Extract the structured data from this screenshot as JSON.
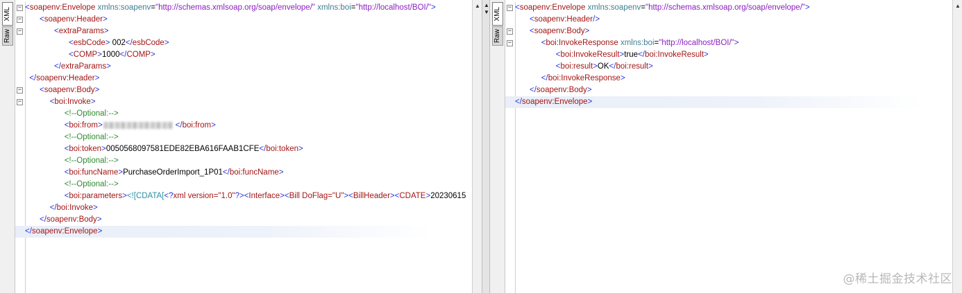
{
  "left_pane": {
    "tabs": {
      "xml": "XML",
      "raw": "Raw"
    },
    "lines": [
      {
        "fold": "⊟",
        "indent": 0,
        "tokens": [
          [
            "br",
            "<"
          ],
          [
            "tag",
            "soapenv:Envelope"
          ],
          [
            "txt",
            " "
          ],
          [
            "attr",
            "xmlns:soapenv"
          ],
          [
            "txt",
            "="
          ],
          [
            "val",
            "\"http://schemas.xmlsoap.org/soap/envelope/\""
          ],
          [
            "txt",
            " "
          ],
          [
            "attr",
            "xmlns:boi"
          ],
          [
            "txt",
            "="
          ],
          [
            "val",
            "\"http://localhost/BOI/\""
          ],
          [
            "br",
            ">"
          ]
        ]
      },
      {
        "fold": "⊟",
        "indent": 1,
        "tokens": [
          [
            "br",
            "<"
          ],
          [
            "tag",
            "soapenv:Header"
          ],
          [
            "br",
            ">"
          ]
        ]
      },
      {
        "fold": "⊟",
        "indent": 2,
        "tokens": [
          [
            "br",
            "<"
          ],
          [
            "tag",
            "extraParams"
          ],
          [
            "br",
            ">"
          ]
        ]
      },
      {
        "fold": "",
        "indent": 3,
        "tokens": [
          [
            "br",
            "<"
          ],
          [
            "tag",
            "esbCode"
          ],
          [
            "br",
            ">"
          ],
          [
            "txt",
            " 002"
          ],
          [
            "br",
            "</"
          ],
          [
            "tag",
            "esbCode"
          ],
          [
            "br",
            ">"
          ]
        ]
      },
      {
        "fold": "",
        "indent": 3,
        "tokens": [
          [
            "br",
            "<"
          ],
          [
            "tag",
            "COMP"
          ],
          [
            "br",
            ">"
          ],
          [
            "txt",
            "1000"
          ],
          [
            "br",
            "</"
          ],
          [
            "tag",
            "COMP"
          ],
          [
            "br",
            ">"
          ]
        ]
      },
      {
        "fold": "",
        "indent": 2,
        "tokens": [
          [
            "br",
            "</"
          ],
          [
            "tag",
            "extraParams"
          ],
          [
            "br",
            ">"
          ]
        ]
      },
      {
        "fold": "",
        "indent": 0.3,
        "tokens": [
          [
            "br",
            "</"
          ],
          [
            "tag",
            "soapenv:Header"
          ],
          [
            "br",
            ">"
          ]
        ]
      },
      {
        "fold": "⊟",
        "indent": 1,
        "tokens": [
          [
            "br",
            "<"
          ],
          [
            "tag",
            "soapenv:Body"
          ],
          [
            "br",
            ">"
          ]
        ]
      },
      {
        "fold": "⊟",
        "indent": 1.7,
        "tokens": [
          [
            "br",
            "<"
          ],
          [
            "tag",
            "boi:Invoke"
          ],
          [
            "br",
            ">"
          ]
        ]
      },
      {
        "fold": "",
        "indent": 2.7,
        "tokens": [
          [
            "com",
            "<!--Optional:-->"
          ]
        ]
      },
      {
        "fold": "",
        "indent": 2.7,
        "tokens": [
          [
            "br",
            "<"
          ],
          [
            "tag",
            "boi:from"
          ],
          [
            "br",
            ">"
          ],
          [
            "blur",
            ""
          ],
          [
            "br",
            "</"
          ],
          [
            "tag",
            "boi:from"
          ],
          [
            "br",
            ">"
          ]
        ]
      },
      {
        "fold": "",
        "indent": 2.7,
        "tokens": [
          [
            "com",
            "<!--Optional:-->"
          ]
        ]
      },
      {
        "fold": "",
        "indent": 2.7,
        "tokens": [
          [
            "br",
            "<"
          ],
          [
            "tag",
            "boi:token"
          ],
          [
            "br",
            ">"
          ],
          [
            "txt",
            "0050568097581EDE82EBA616FAAB1CFE"
          ],
          [
            "br",
            "</"
          ],
          [
            "tag",
            "boi:token"
          ],
          [
            "br",
            ">"
          ]
        ]
      },
      {
        "fold": "",
        "indent": 2.7,
        "tokens": [
          [
            "com",
            "<!--Optional:-->"
          ]
        ]
      },
      {
        "fold": "",
        "indent": 2.7,
        "tokens": [
          [
            "br",
            "<"
          ],
          [
            "tag",
            "boi:funcName"
          ],
          [
            "br",
            ">"
          ],
          [
            "txt",
            "PurchaseOrderImport_1P01"
          ],
          [
            "br",
            "</"
          ],
          [
            "tag",
            "boi:funcName"
          ],
          [
            "br",
            ">"
          ]
        ]
      },
      {
        "fold": "",
        "indent": 2.7,
        "tokens": [
          [
            "com",
            "<!--Optional:-->"
          ]
        ]
      },
      {
        "fold": "",
        "indent": 2.7,
        "tokens": [
          [
            "br",
            "<"
          ],
          [
            "tag",
            "boi:parameters"
          ],
          [
            "br",
            ">"
          ],
          [
            "cdata",
            "<![CDATA["
          ],
          [
            "br",
            "<?"
          ],
          [
            "tag",
            "xml version=\"1.0\""
          ],
          [
            "br",
            "?>"
          ],
          [
            "br",
            "<"
          ],
          [
            "tag",
            "Interface"
          ],
          [
            "br",
            ">"
          ],
          [
            "br",
            "<"
          ],
          [
            "tag",
            "Bill DoFlag=\"U\""
          ],
          [
            "br",
            ">"
          ],
          [
            "br",
            "<"
          ],
          [
            "tag",
            "BillHeader"
          ],
          [
            "br",
            ">"
          ],
          [
            "br",
            "<"
          ],
          [
            "tag",
            "CDATE"
          ],
          [
            "br",
            ">"
          ],
          [
            "txt",
            "20230615"
          ]
        ]
      },
      {
        "fold": "",
        "indent": 1.7,
        "tokens": [
          [
            "br",
            "</"
          ],
          [
            "tag",
            "boi:Invoke"
          ],
          [
            "br",
            ">"
          ]
        ]
      },
      {
        "fold": "",
        "indent": 1,
        "tokens": [
          [
            "br",
            "</"
          ],
          [
            "tag",
            "soapenv:Body"
          ],
          [
            "br",
            ">"
          ]
        ]
      },
      {
        "fold": "",
        "indent": 0,
        "cur": true,
        "tokens": [
          [
            "br",
            "</"
          ],
          [
            "tag",
            "soapenv:Envelope"
          ],
          [
            "br",
            ">"
          ]
        ]
      }
    ]
  },
  "right_pane": {
    "tabs": {
      "xml": "XML",
      "raw": "Raw"
    },
    "lines": [
      {
        "fold": "⊟",
        "indent": 0,
        "tokens": [
          [
            "br",
            "<"
          ],
          [
            "tag",
            "soapenv:Envelope"
          ],
          [
            "txt",
            " "
          ],
          [
            "attr",
            "xmlns:soapenv"
          ],
          [
            "txt",
            "="
          ],
          [
            "val",
            "\"http://schemas.xmlsoap.org/soap/envelope/\""
          ],
          [
            "br",
            ">"
          ]
        ]
      },
      {
        "fold": "",
        "indent": 1,
        "tokens": [
          [
            "br",
            "<"
          ],
          [
            "tag",
            "soapenv:Header"
          ],
          [
            "br",
            "/>"
          ]
        ]
      },
      {
        "fold": "⊟",
        "indent": 1,
        "tokens": [
          [
            "br",
            "<"
          ],
          [
            "tag",
            "soapenv:Body"
          ],
          [
            "br",
            ">"
          ]
        ]
      },
      {
        "fold": "⊟",
        "indent": 1.8,
        "tokens": [
          [
            "br",
            "<"
          ],
          [
            "tag",
            "boi:InvokeResponse"
          ],
          [
            "txt",
            " "
          ],
          [
            "attr",
            "xmlns:boi"
          ],
          [
            "txt",
            "="
          ],
          [
            "val",
            "\"http://localhost/BOI/\""
          ],
          [
            "br",
            ">"
          ]
        ]
      },
      {
        "fold": "",
        "indent": 2.8,
        "tokens": [
          [
            "br",
            "<"
          ],
          [
            "tag",
            "boi:InvokeResult"
          ],
          [
            "br",
            ">"
          ],
          [
            "txt",
            "true"
          ],
          [
            "br",
            "</"
          ],
          [
            "tag",
            "boi:InvokeResult"
          ],
          [
            "br",
            ">"
          ]
        ]
      },
      {
        "fold": "",
        "indent": 2.8,
        "tokens": [
          [
            "br",
            "<"
          ],
          [
            "tag",
            "boi:result"
          ],
          [
            "br",
            ">"
          ],
          [
            "txt",
            "OK"
          ],
          [
            "br",
            "</"
          ],
          [
            "tag",
            "boi:result"
          ],
          [
            "br",
            ">"
          ]
        ]
      },
      {
        "fold": "",
        "indent": 1.8,
        "tokens": [
          [
            "br",
            "</"
          ],
          [
            "tag",
            "boi:InvokeResponse"
          ],
          [
            "br",
            ">"
          ]
        ]
      },
      {
        "fold": "",
        "indent": 1,
        "tokens": [
          [
            "br",
            "</"
          ],
          [
            "tag",
            "soapenv:Body"
          ],
          [
            "br",
            ">"
          ]
        ]
      },
      {
        "fold": "",
        "indent": 0,
        "cur": true,
        "tokens": [
          [
            "br",
            "</"
          ],
          [
            "tag",
            "soapenv:Envelope"
          ],
          [
            "br",
            ">"
          ]
        ]
      }
    ]
  },
  "icons": {
    "fold": "collapse-minus-icon",
    "scroll_up": "scroll-up-arrow-icon",
    "splitter_up": "splitter-expand-up-icon",
    "splitter_down": "splitter-expand-down-icon"
  },
  "glyphs": {
    "scroll_up": "▲",
    "split_up": "▲",
    "split_down": "▼"
  },
  "watermark": "@稀土掘金技术社区",
  "colors": {
    "bracket": "#2b36d6",
    "tag": "#a31515",
    "attr": "#3f7f8f",
    "value": "#8b1fc0",
    "comment": "#2f8a2f",
    "cdata": "#2b8fa8"
  }
}
